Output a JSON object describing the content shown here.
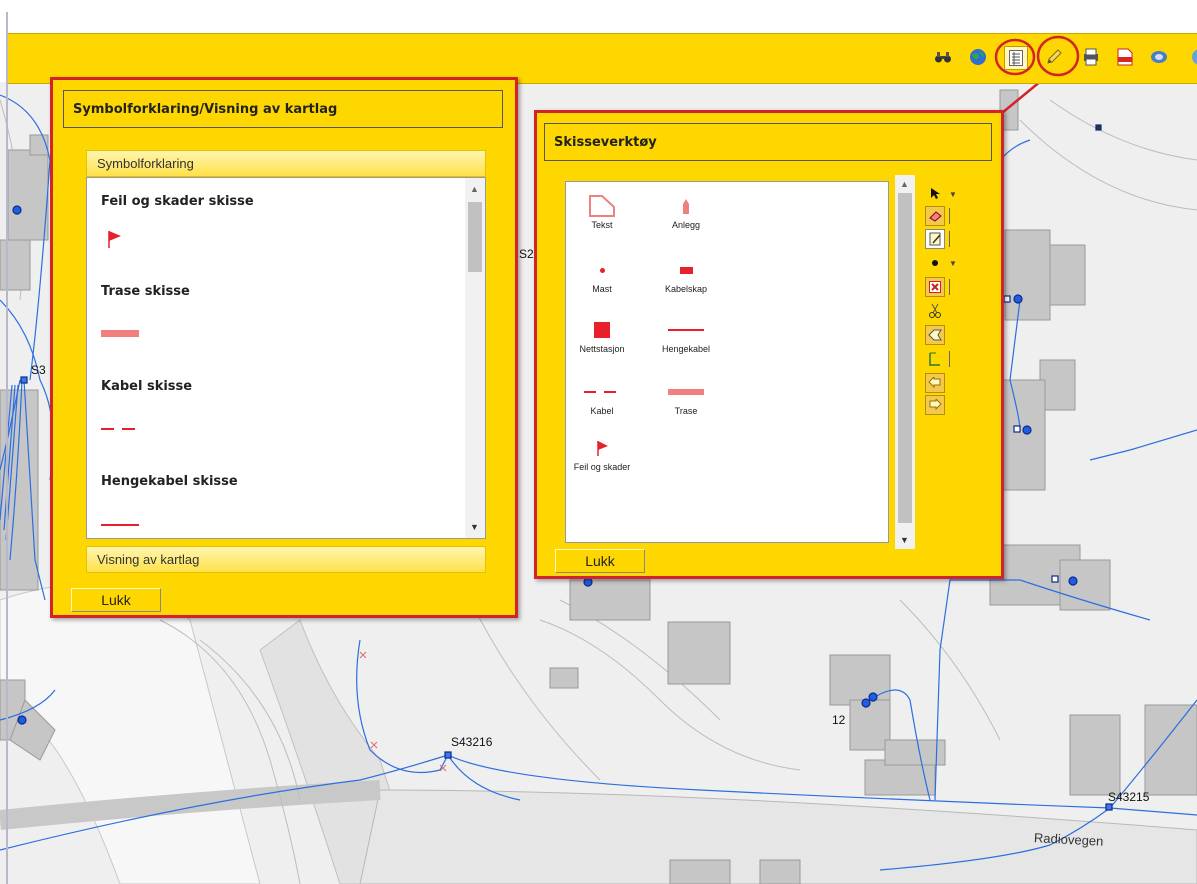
{
  "map": {
    "labels": {
      "s43216": "S43216",
      "s43215": "S43215",
      "road": "Radiovegen",
      "house12": "12",
      "s3_clip": "S3",
      "s2_clip": "S2"
    }
  },
  "toolbar": {
    "icons": [
      "binoculars-icon",
      "globe-icon",
      "legend-icon",
      "pencil-icon",
      "print-map-icon",
      "pdf-icon",
      "streetview-icon",
      "help-icon"
    ]
  },
  "legend_panel": {
    "title": "Symbolforklaring/Visning av kartlag",
    "section_symbols": "Symbolforklaring",
    "section_layers": "Visning av kartlag",
    "items": [
      {
        "label": "Feil og skader skisse",
        "symbol": "flag"
      },
      {
        "label": "Trase skisse",
        "symbol": "thick-line"
      },
      {
        "label": "Kabel skisse",
        "symbol": "dashed-line"
      },
      {
        "label": "Hengekabel skisse",
        "symbol": "thin-line"
      }
    ],
    "close_label": "Lukk"
  },
  "sketch_panel": {
    "title": "Skisseverktøy",
    "symbols": [
      {
        "label": "Tekst",
        "symbol": "text-shape"
      },
      {
        "label": "Anlegg",
        "symbol": "house-shape"
      },
      {
        "label": "Mast",
        "symbol": "dot"
      },
      {
        "label": "Kabelskap",
        "symbol": "small-rect"
      },
      {
        "label": "Nettstasjon",
        "symbol": "square"
      },
      {
        "label": "Hengekabel",
        "symbol": "thin-line"
      },
      {
        "label": "Kabel",
        "symbol": "dashed-line"
      },
      {
        "label": "Trase",
        "symbol": "thick-line"
      },
      {
        "label": "Feil og skader",
        "symbol": "flag"
      }
    ],
    "tools": [
      "select-arrow-icon",
      "eraser-icon",
      "edit-note-icon",
      "point-icon",
      "delete-icon",
      "cut-icon",
      "reshape-icon",
      "measure-icon",
      "undo-icon",
      "redo-icon"
    ],
    "close_label": "Lukk"
  },
  "colors": {
    "accent": "#ffd700",
    "panel_border": "#d2232a",
    "symbol_red": "#e8202a",
    "symbol_pink": "#f08080",
    "cable_blue": "#2b6fe0"
  }
}
